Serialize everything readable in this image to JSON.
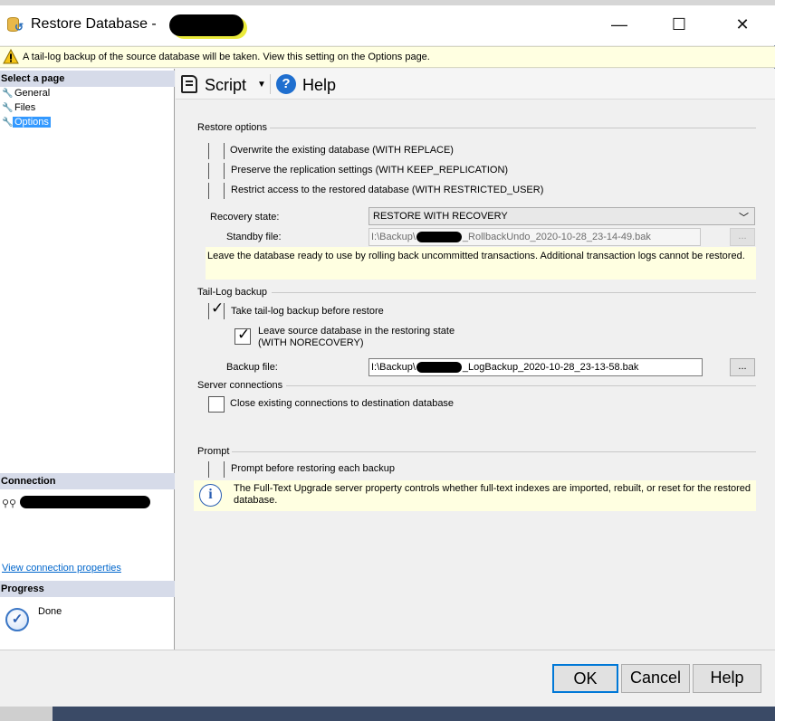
{
  "window": {
    "title": "Restore Database -",
    "minimize_glyph": "—",
    "maximize_glyph": "☐",
    "close_glyph": "✕"
  },
  "infobar": {
    "icon": "warning-icon",
    "text": "A tail-log backup of the source database will be taken. View this setting on the Options page."
  },
  "sidebar": {
    "select_page_header": "Select a page",
    "items": [
      {
        "label": "General",
        "icon": "wrench-icon",
        "selected": false
      },
      {
        "label": "Files",
        "icon": "wrench-icon",
        "selected": false
      },
      {
        "label": "Options",
        "icon": "wrench-icon",
        "selected": true
      }
    ],
    "connection_header": "Connection",
    "view_connection_link": "View connection properties",
    "progress_header": "Progress",
    "progress_status": "Done"
  },
  "toolbar": {
    "script_label": "Script",
    "help_label": "Help"
  },
  "restore_options": {
    "title": "Restore options",
    "overwrite_label": "Overwrite the existing database (WITH REPLACE)",
    "overwrite_checked": false,
    "preserve_label": "Preserve the replication settings (WITH KEEP_REPLICATION)",
    "preserve_checked": false,
    "restrict_label": "Restrict access to the restored database (WITH RESTRICTED_USER)",
    "restrict_checked": false,
    "recovery_state_label": "Recovery state:",
    "recovery_state_value": "RESTORE WITH RECOVERY",
    "standby_file_label": "Standby file:",
    "standby_prefix": "I:\\Backup\\",
    "standby_suffix": "_RollbackUndo_2020-10-28_23-14-49.bak",
    "browse_label": "...",
    "description": "Leave the database ready to use by rolling back uncommitted transactions. Additional transaction logs cannot be restored."
  },
  "tail_log": {
    "title": "Tail-Log backup",
    "take_label": "Take tail-log backup before restore",
    "take_checked": true,
    "leave_label_line1": "Leave source database in the restoring state",
    "leave_label_line2": "(WITH NORECOVERY)",
    "leave_checked": true,
    "backup_file_label": "Backup file:",
    "backup_prefix": "I:\\Backup\\",
    "backup_suffix": "_LogBackup_2020-10-28_23-13-58.bak",
    "browse_label": "..."
  },
  "server_connections": {
    "title": "Server connections",
    "close_label": "Close existing connections to destination database",
    "close_checked": false
  },
  "prompt": {
    "title": "Prompt",
    "prompt_label": "Prompt before restoring each backup",
    "prompt_checked": false,
    "info_line1": "The Full-Text Upgrade server property controls whether full-text indexes are imported, rebuilt, or reset for the restored",
    "info_line2": "database."
  },
  "buttons": {
    "ok": "OK",
    "cancel": "Cancel",
    "help": "Help"
  },
  "colors": {
    "selection": "#3399ff",
    "info_background": "#ffffe1",
    "default_button_border": "#0078d7",
    "link": "#0066cc"
  }
}
